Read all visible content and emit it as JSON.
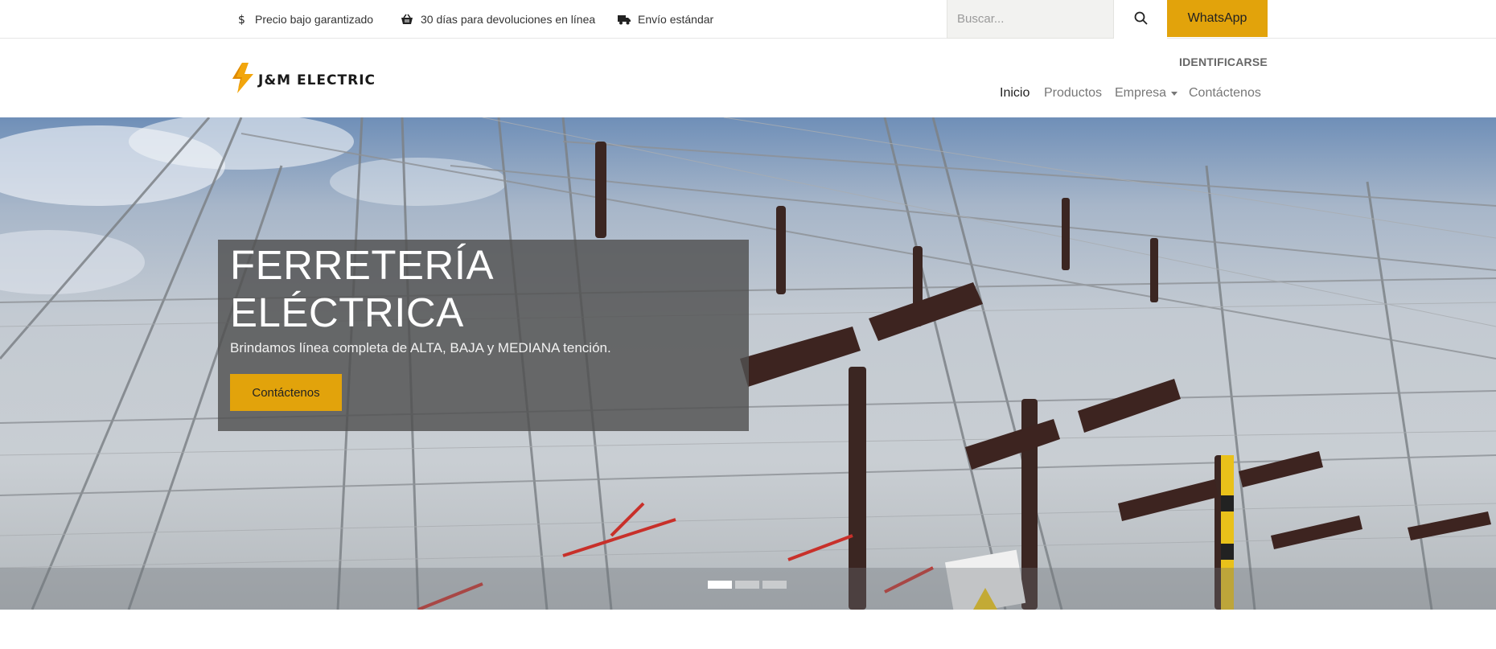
{
  "topbar": {
    "promos": [
      {
        "icon": "dollar-icon",
        "label": "Precio bajo garantizado"
      },
      {
        "icon": "basket-icon",
        "label": "30 días para devoluciones en línea"
      },
      {
        "icon": "truck-icon",
        "label": "Envío estándar"
      }
    ],
    "search": {
      "placeholder": "Buscar..."
    },
    "whatsapp_label": "WhatsApp"
  },
  "header": {
    "logo_text": "J&M ELECTRIC",
    "signin_label": "IDENTIFICARSE",
    "nav": {
      "inicio": "Inicio",
      "productos": "Productos",
      "empresa": "Empresa",
      "contacto": "Contáctenos"
    }
  },
  "hero": {
    "title": "FERRETERÍA ELÉCTRICA",
    "subtitle": "Brindamos línea completa de ALTA, BAJA y MEDIANA tención.",
    "cta_label": "Contáctenos",
    "slides_total": 3,
    "active_slide": 1
  },
  "colors": {
    "accent": "#e2a30b",
    "caption_bg": "#505050"
  }
}
